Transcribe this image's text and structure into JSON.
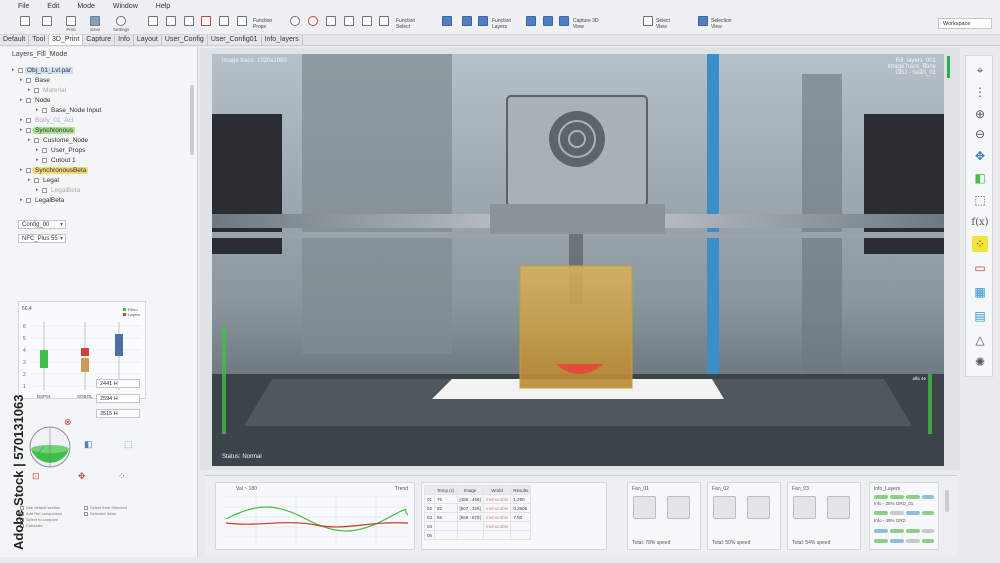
{
  "menu": [
    "File",
    "Edit",
    "Mode",
    "Window",
    "Help"
  ],
  "toolbar": {
    "left_buttons": [
      "Print",
      "Save",
      "Settings"
    ],
    "group_labels": [
      "Function Props",
      "Function Select",
      "Function Layers",
      "Capture 3D View",
      "Select View",
      "Selection View"
    ],
    "workspace": "Workspace"
  },
  "tabs": [
    "Default",
    "Tool",
    "3D_Print",
    "Capture",
    "Info",
    "Layout",
    "User_Config",
    "User_Config01",
    "Info_layers"
  ],
  "left_panel": {
    "title": "Layers_Fill_Mode",
    "tree": [
      {
        "label": "Obj_01_Lvl.par",
        "style": "blue",
        "indent": 0
      },
      {
        "label": "Base",
        "indent": 1
      },
      {
        "label": "Material",
        "style": "dim",
        "indent": 2
      },
      {
        "label": "Node",
        "indent": 1
      },
      {
        "label": "Base_Node Input",
        "indent": 3
      },
      {
        "label": "Body_01_Act",
        "style": "dim",
        "indent": 1
      },
      {
        "label": "Synchronous",
        "style": "green",
        "indent": 1
      },
      {
        "label": "Custome_Node",
        "indent": 2
      },
      {
        "label": "User_Props",
        "indent": 3
      },
      {
        "label": "Cutout 1",
        "indent": 3
      },
      {
        "label": "SynchronousBeta",
        "style": "yellow",
        "indent": 1
      },
      {
        "label": "Legal",
        "indent": 2
      },
      {
        "label": "LegalBeta",
        "style": "dim",
        "indent": 3
      },
      {
        "label": "LegalBeta",
        "indent": 1
      }
    ],
    "config": "Config_00",
    "preset": "NFC_Plus 55",
    "num_fields": [
      "2441 H",
      "2594 H",
      "3515 H"
    ],
    "footnotes": [
      "Use default section",
      "Add Ref comparison",
      "Select to compare",
      "Calculate"
    ],
    "footnotes_right": [
      "Select from Selected",
      "Selected Inline"
    ]
  },
  "chart_data": {
    "type": "bar",
    "title": "56.4",
    "legend": [
      "Filled",
      "Layers"
    ],
    "categories": [
      "BSP01",
      "SOBOL"
    ],
    "y_ticks": [
      "6",
      "5",
      "4",
      "3",
      "2",
      "1"
    ]
  },
  "viewport": {
    "top_left": "Image trace: 1920x1080",
    "top_right": [
      "Fill_layers_001",
      "Image trace_done",
      "OBJ - heart_01"
    ],
    "status": "Status: Normal",
    "gauge_label": "alfa 4e"
  },
  "bottom": {
    "trend": {
      "title_left": "Val ~ 180",
      "title_right": "Trend"
    },
    "table": {
      "headers": [
        "",
        "Temp (c)",
        "Image",
        "World",
        "Results"
      ],
      "rows": [
        [
          "01",
          "76",
          "[456 : 468]",
          "memorable",
          "1.290"
        ],
        [
          "02",
          "82",
          "[507 : 325]",
          "memorable",
          "0.2605"
        ],
        [
          "03",
          "56",
          "[569 : 679]",
          "memorable",
          "7.90"
        ],
        [
          "04",
          "",
          "",
          "memorable",
          ""
        ],
        [
          "05",
          "",
          "",
          "",
          ""
        ]
      ]
    },
    "fans": [
      {
        "name": "Fan_01",
        "speed": "Total: 78% speed"
      },
      {
        "name": "Fan_02",
        "speed": "Total: 50% speed"
      },
      {
        "name": "Fan_03",
        "speed": "Total: 54% speed"
      }
    ],
    "info": {
      "title": "Info_Layers",
      "lines": [
        "Info - 25% GRD_01",
        "Info - 48% GRD"
      ]
    }
  },
  "watermark": {
    "id": "570131063",
    "brand": "Adobe Stock"
  },
  "colors": {
    "accent_green": "#22b14c",
    "highlight_green": "#a8e28a",
    "highlight_yellow": "#f3d77a",
    "select_blue": "#cfe0f5"
  }
}
